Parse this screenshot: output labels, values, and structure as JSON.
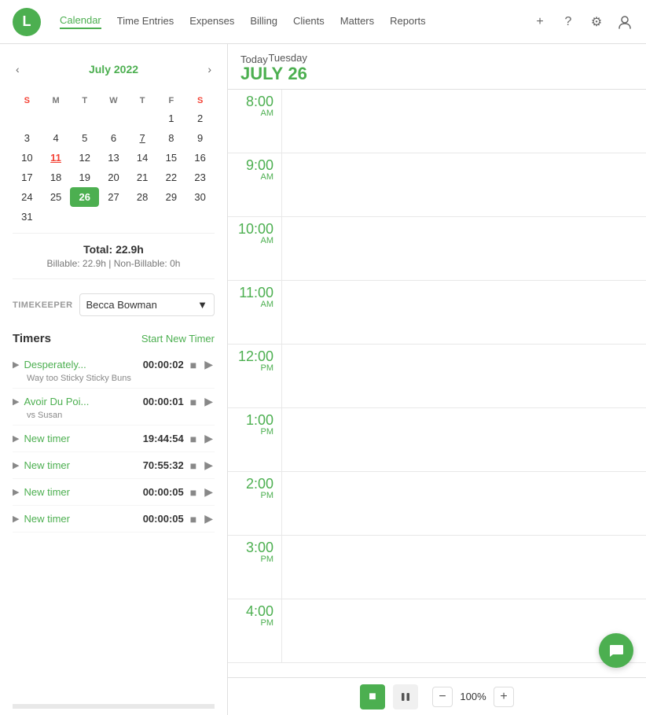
{
  "app": {
    "logo_letter": "L"
  },
  "nav": {
    "links": [
      {
        "id": "calendar",
        "label": "Calendar",
        "active": true
      },
      {
        "id": "time-entries",
        "label": "Time Entries",
        "active": false
      },
      {
        "id": "expenses",
        "label": "Expenses",
        "active": false
      },
      {
        "id": "billing",
        "label": "Billing",
        "active": false
      },
      {
        "id": "clients",
        "label": "Clients",
        "active": false
      },
      {
        "id": "matters",
        "label": "Matters",
        "active": false
      },
      {
        "id": "reports",
        "label": "Reports",
        "active": false
      }
    ],
    "actions": {
      "add": "+",
      "help": "?",
      "settings": "⚙",
      "account": "👤"
    }
  },
  "sidebar": {
    "calendar": {
      "title": "July 2022",
      "weekdays": [
        "S",
        "M",
        "T",
        "W",
        "T",
        "F",
        "S"
      ],
      "weeks": [
        [
          null,
          null,
          null,
          null,
          null,
          1,
          2
        ],
        [
          3,
          4,
          5,
          6,
          7,
          8,
          9
        ],
        [
          10,
          11,
          12,
          13,
          14,
          15,
          16
        ],
        [
          17,
          18,
          19,
          20,
          21,
          22,
          23
        ],
        [
          24,
          25,
          26,
          27,
          28,
          29,
          30
        ],
        [
          31,
          null,
          null,
          null,
          null,
          null,
          null
        ]
      ],
      "today": 11,
      "selected": 26,
      "underlined": 7
    },
    "totals": {
      "label": "Total: 22.9h",
      "billable_label": "Billable: 22.9h",
      "non_billable_label": "Non-Billable: 0h"
    },
    "timekeeper": {
      "label": "TIMEKEEPER",
      "value": "Becca Bowman"
    },
    "timers": {
      "title": "Timers",
      "new_timer_label": "Start New Timer",
      "items": [
        {
          "name": "Desperately...",
          "time": "00:00:02",
          "sub": "Way too Sticky Sticky Buns"
        },
        {
          "name": "Avoir Du Poi...",
          "time": "00:00:01",
          "sub": "vs Susan"
        },
        {
          "name": "New timer",
          "time": "19:44:54",
          "sub": ""
        },
        {
          "name": "New timer",
          "time": "70:55:32",
          "sub": ""
        },
        {
          "name": "New timer",
          "time": "00:00:05",
          "sub": ""
        },
        {
          "name": "New timer",
          "time": "00:00:05",
          "sub": ""
        }
      ]
    }
  },
  "calendar_right": {
    "today_label": "Today",
    "weekday": "Tuesday",
    "month": "JULY",
    "day": "26",
    "time_slots": [
      {
        "hour": "8:00",
        "ampm": "AM"
      },
      {
        "hour": "9:00",
        "ampm": "AM"
      },
      {
        "hour": "10:00",
        "ampm": "AM"
      },
      {
        "hour": "11:00",
        "ampm": "AM"
      },
      {
        "hour": "12:00",
        "ampm": "PM"
      },
      {
        "hour": "1:00",
        "ampm": "PM"
      },
      {
        "hour": "2:00",
        "ampm": "PM"
      },
      {
        "hour": "3:00",
        "ampm": "PM"
      },
      {
        "hour": "4:00",
        "ampm": "PM"
      }
    ]
  },
  "toolbar": {
    "stop_label": "■",
    "pause_label": "⏸",
    "zoom_minus": "−",
    "zoom_pct": "100%",
    "zoom_plus": "+"
  },
  "chat": {
    "icon": "💬"
  }
}
